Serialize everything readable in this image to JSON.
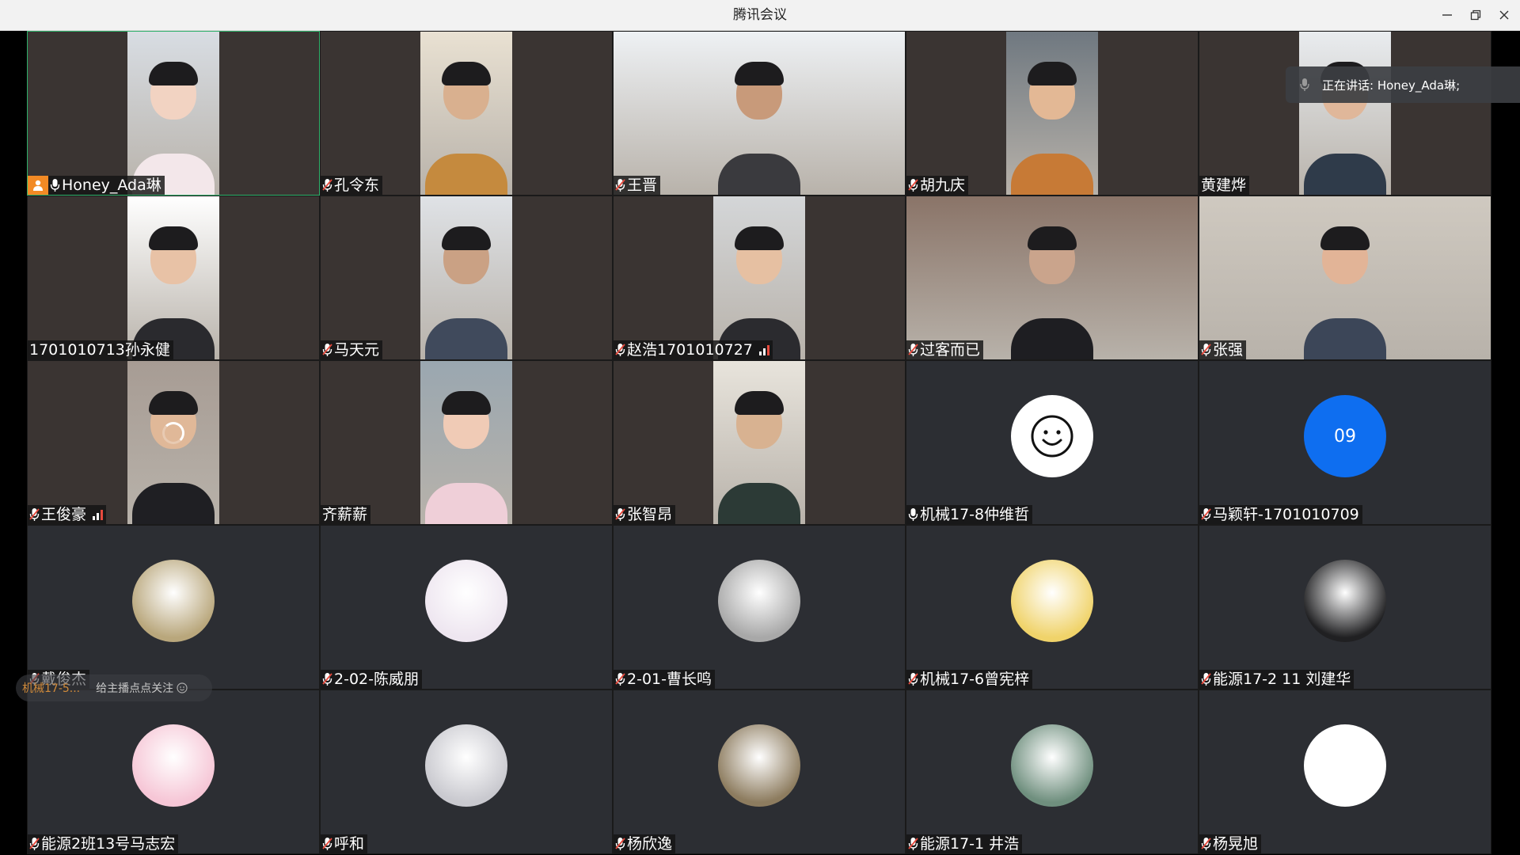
{
  "window": {
    "title": "腾讯会议"
  },
  "window_controls": {
    "minimize": "minimize",
    "restore": "restore",
    "close": "close"
  },
  "speaking": {
    "text": "正在讲话: Honey_Ada琳;"
  },
  "follow_banner": {
    "name": "机械17-5...",
    "text": "给主播点点关注"
  },
  "participants": [
    {
      "name": "Honey_Ada琳",
      "mic": "on",
      "host": true,
      "view": "video",
      "active": true
    },
    {
      "name": "孔令东",
      "mic": "muted",
      "view": "video"
    },
    {
      "name": "王晋",
      "mic": "muted",
      "view": "video"
    },
    {
      "name": "胡九庆",
      "mic": "muted",
      "view": "video"
    },
    {
      "name": "黄建烨",
      "mic": "none",
      "view": "video"
    },
    {
      "name": "1701010713孙永健",
      "mic": "none",
      "view": "video"
    },
    {
      "name": "马天元",
      "mic": "muted",
      "view": "video"
    },
    {
      "name": "赵浩1701010727",
      "mic": "muted",
      "view": "video",
      "signal": "partial"
    },
    {
      "name": "过客而已",
      "mic": "muted",
      "view": "video"
    },
    {
      "name": "张强",
      "mic": "muted",
      "view": "video"
    },
    {
      "name": "王俊豪",
      "mic": "muted",
      "view": "video",
      "signal": "partial",
      "loading": true
    },
    {
      "name": "齐薪薪",
      "mic": "none",
      "view": "video"
    },
    {
      "name": "张智昂",
      "mic": "muted",
      "view": "video"
    },
    {
      "name": "机械17-8仲维哲",
      "mic": "on",
      "view": "avatar",
      "avatar": "smiley-icon"
    },
    {
      "name": "马颖轩-1701010709",
      "mic": "muted",
      "view": "avatar",
      "avatar_text": "09"
    },
    {
      "name": "戴俊杰",
      "mic": "muted",
      "view": "avatar",
      "avatar": "double-happiness-icon"
    },
    {
      "name": "2-02-陈威朋",
      "mic": "muted",
      "view": "avatar",
      "avatar": "anime-girl-avatar"
    },
    {
      "name": "2-01-曹长鸣",
      "mic": "muted",
      "view": "avatar",
      "avatar": "guitar-player-avatar"
    },
    {
      "name": "机械17-6曾宪梓",
      "mic": "muted",
      "view": "avatar",
      "avatar": "pikachu-avatar"
    },
    {
      "name": "能源17-2 11 刘建华",
      "mic": "muted",
      "view": "avatar",
      "avatar": "suit-avatar"
    },
    {
      "name": "能源2班13号马志宏",
      "mic": "muted",
      "view": "avatar",
      "avatar": "chibi-girl-avatar"
    },
    {
      "name": "呼和",
      "mic": "muted",
      "view": "avatar",
      "avatar": "husky-avatar"
    },
    {
      "name": "杨欣逸",
      "mic": "muted",
      "view": "avatar",
      "avatar": "waterfall-avatar"
    },
    {
      "name": "能源17-1 井浩",
      "mic": "muted",
      "view": "avatar",
      "avatar": "anime-boy-avatar"
    },
    {
      "name": "杨晃旭",
      "mic": "muted",
      "view": "avatar",
      "avatar": "sleeping-pikachu-avatar"
    }
  ],
  "colors": {
    "video_bg": "#3a3432",
    "avatar_bg": "#2c2e33",
    "active_border": "#2fb06a",
    "host_badge": "#f28a25",
    "muted_slash": "#e84a3d",
    "avatar_blue": "#0e6ef0"
  }
}
